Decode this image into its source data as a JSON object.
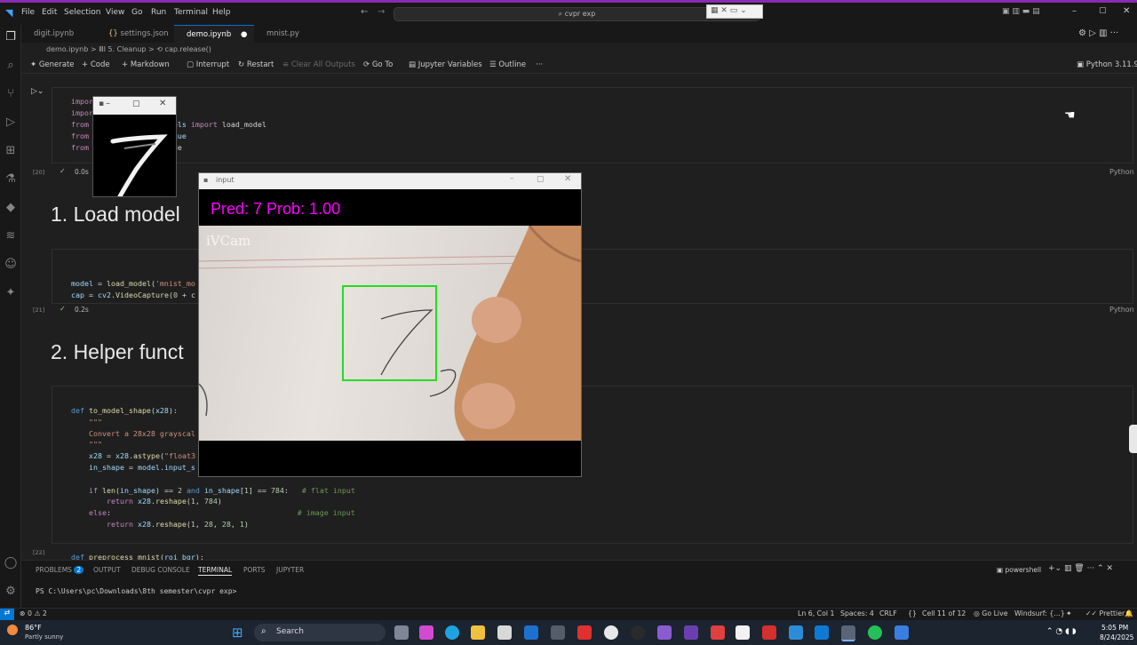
{
  "titlebar": {
    "menus": [
      "File",
      "Edit",
      "Selection",
      "View",
      "Go",
      "Run",
      "Terminal",
      "Help"
    ],
    "search_text": "cvpr exp"
  },
  "tabs": [
    {
      "label": "digit.ipynb",
      "active": false
    },
    {
      "label": "settings.json",
      "active": false
    },
    {
      "label": "demo.ipynb",
      "active": true,
      "modified": true
    },
    {
      "label": "mnist.py",
      "active": false
    }
  ],
  "breadcrumb": "demo.ipynb > ⅢⅠ 5. Cleanup > ⟲ cap.release()",
  "notebook_toolbar": {
    "generate": "Generate",
    "code": "Code",
    "markdown": "Markdown",
    "interrupt": "Interrupt",
    "restart": "Restart",
    "clear": "Clear All Outputs",
    "goto": "Go To",
    "variables": "Jupyter Variables",
    "outline": "Outline",
    "more": "···",
    "kernel": "Python 3.11.9"
  },
  "cells": {
    "c1": {
      "exec": "[20]",
      "time": "0.0s",
      "lang": "Python"
    },
    "h1": "1. Load model",
    "c2": {
      "exec": "[21]",
      "time": "0.2s",
      "lang": "Python"
    },
    "h2": "2. Helper funct",
    "c3": {
      "exec": "[22]"
    }
  },
  "digit_window": {
    "title": "–"
  },
  "input_window": {
    "title": "input",
    "prediction": "Pred: 7   Prob: 1.00",
    "watermark": "iVCam"
  },
  "panel": {
    "tabs": [
      "PROBLEMS",
      "OUTPUT",
      "DEBUG CONSOLE",
      "TERMINAL",
      "PORTS",
      "JUPYTER"
    ],
    "problems_count": "2",
    "shell": "powershell",
    "prompt": "PS C:\\Users\\pc\\Downloads\\8th semester\\cvpr exp>"
  },
  "statusbar": {
    "left": "⊗ 0 ⚠ 2",
    "pos": "Ln 6, Col 1",
    "spaces": "Spaces: 4",
    "eol": "CRLF",
    "cell": "Cell 11 of 12",
    "golive": "Go Live",
    "windsurf": "Windsurf: {...}",
    "prettier": "Prettier"
  },
  "taskbar": {
    "weather_temp": "86°F",
    "weather_desc": "Partly sunny",
    "search": "Search",
    "time": "5:05 PM",
    "date": "8/24/2025"
  },
  "colors": {
    "accent": "#0078d4",
    "prediction": "#ff00ff",
    "roi_box": "#22dd22",
    "title_accent": "#8a2bb0"
  }
}
